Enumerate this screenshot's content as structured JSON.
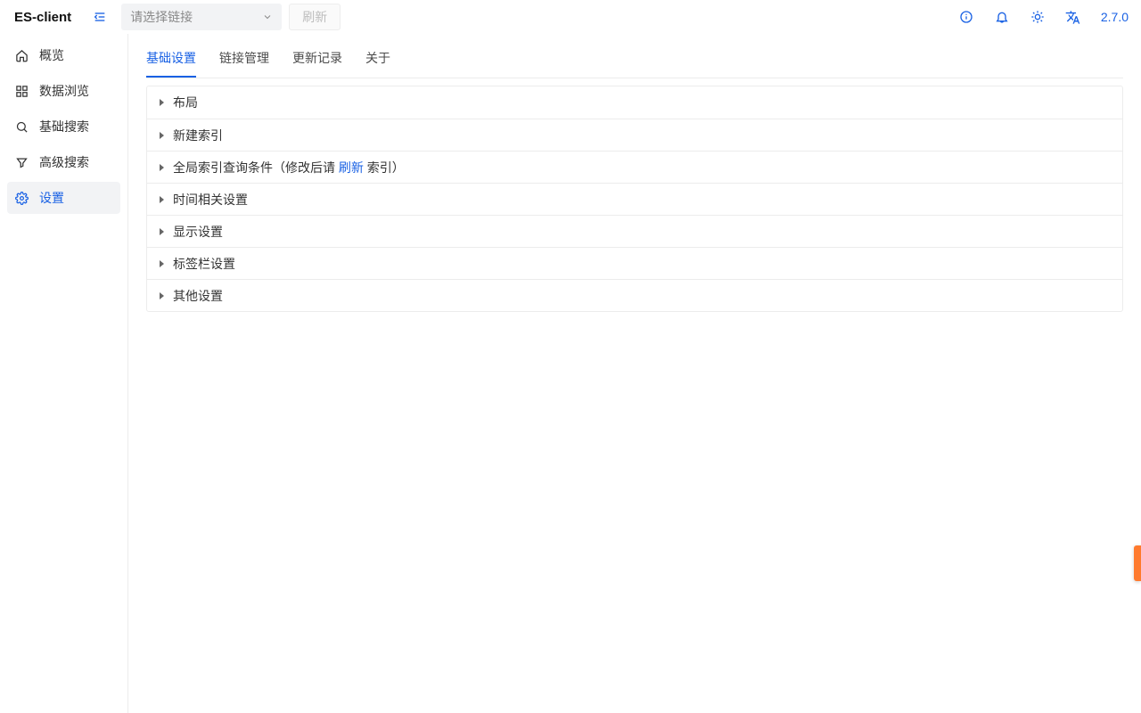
{
  "header": {
    "brand": "ES-client",
    "select_placeholder": "请选择链接",
    "refresh_label": "刷新",
    "version": "2.7.0"
  },
  "sidebar": {
    "items": [
      {
        "icon": "home-icon",
        "label": "概览"
      },
      {
        "icon": "grid-icon",
        "label": "数据浏览"
      },
      {
        "icon": "search-icon",
        "label": "基础搜索"
      },
      {
        "icon": "filter-icon",
        "label": "高级搜索"
      },
      {
        "icon": "gear-icon",
        "label": "设置"
      }
    ]
  },
  "tabs": [
    {
      "label": "基础设置",
      "active": true
    },
    {
      "label": "链接管理"
    },
    {
      "label": "更新记录"
    },
    {
      "label": "关于"
    }
  ],
  "accordion": [
    {
      "title": "布局"
    },
    {
      "title": "新建索引"
    },
    {
      "prefix": "全局索引查询条件（修改后请 ",
      "link": "刷新",
      "suffix": " 索引）"
    },
    {
      "title": "时间相关设置"
    },
    {
      "title": "显示设置"
    },
    {
      "title": "标签栏设置"
    },
    {
      "title": "其他设置"
    }
  ]
}
